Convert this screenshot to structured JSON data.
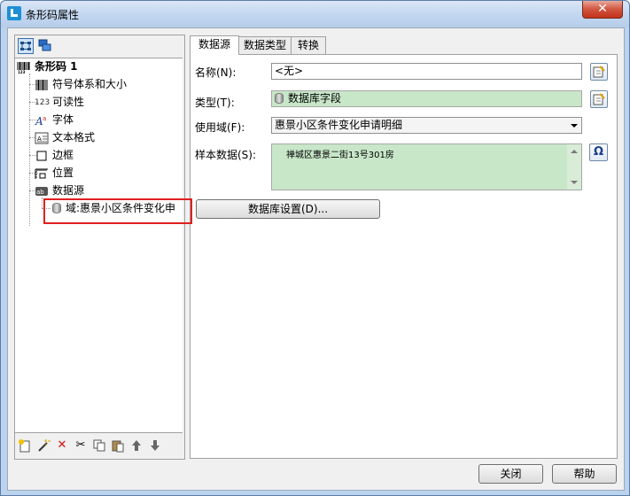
{
  "window": {
    "title": "条形码属性",
    "close_glyph": "✕"
  },
  "tree": {
    "root_label": "条形码 1",
    "items": [
      {
        "label": "符号体系和大小",
        "icon": "barcode-icon"
      },
      {
        "label": "可读性",
        "icon": "readability-icon",
        "icon_text": "123"
      },
      {
        "label": "字体",
        "icon": "font-icon"
      },
      {
        "label": "文本格式",
        "icon": "text-format-icon"
      },
      {
        "label": "边框",
        "icon": "border-icon"
      },
      {
        "label": "位置",
        "icon": "position-icon"
      },
      {
        "label": "数据源",
        "icon": "datasource-icon"
      }
    ],
    "child_label": "域:惠景小区条件变化申"
  },
  "tabs": [
    {
      "label": "数据源",
      "active": true
    },
    {
      "label": "数据类型",
      "active": false
    },
    {
      "label": "转换",
      "active": false
    }
  ],
  "form": {
    "name_label": "名称(N):",
    "name_value": "<无>",
    "type_label": "类型(T):",
    "type_value": "数据库字段",
    "scope_label": "使用域(F):",
    "scope_value": "惠景小区条件变化申请明细",
    "sample_label": "样本数据(S):",
    "sample_value": "禅城区惠景二街13号301房",
    "db_settings_button": "数据库设置(D)...",
    "omega_glyph": "Ω"
  },
  "footer": {
    "close_button": "关闭",
    "help_button": "帮助"
  }
}
